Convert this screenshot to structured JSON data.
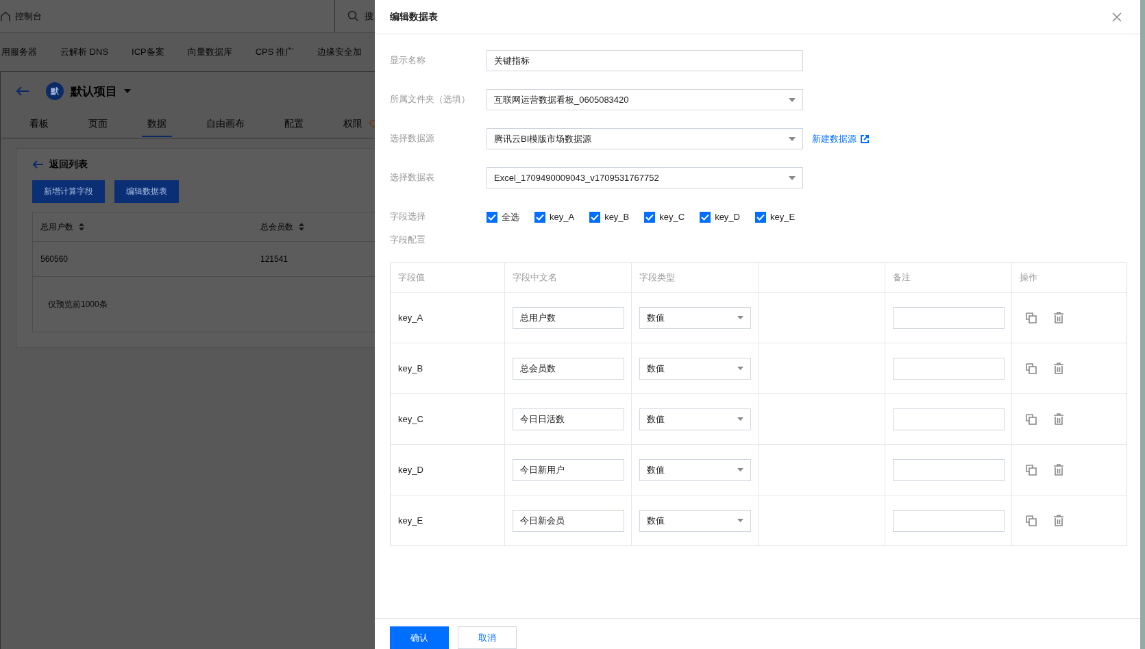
{
  "background": {
    "topbar": {
      "home_label": "控制台",
      "search_label": "搜"
    },
    "nav": [
      "用服务器",
      "云解析 DNS",
      "ICP备案",
      "向量数据库",
      "CPS 推广",
      "边缘安全加"
    ],
    "project": {
      "avatar": "默",
      "name": "默认项目"
    },
    "tabs": [
      {
        "label": "看板",
        "selected": false,
        "premium": false
      },
      {
        "label": "页面",
        "selected": false,
        "premium": false
      },
      {
        "label": "数据",
        "selected": true,
        "premium": false
      },
      {
        "label": "自由画布",
        "selected": false,
        "premium": false
      },
      {
        "label": "配置",
        "selected": false,
        "premium": false
      },
      {
        "label": "权限",
        "selected": false,
        "premium": true
      }
    ],
    "panel": {
      "back_label": "返回列表",
      "buttons": [
        "新增计算字段",
        "编辑数据表"
      ],
      "table": {
        "columns": [
          {
            "label": "总用户数",
            "sortable": true
          },
          {
            "label": "总会员数",
            "sortable": true
          }
        ],
        "rows": [
          [
            "560560",
            "121541"
          ]
        ],
        "footer": "仅预览前1000条"
      }
    }
  },
  "drawer": {
    "title": "编辑数据表",
    "form": [
      {
        "kind": "input",
        "label": "显示名称",
        "value": "关键指标"
      },
      {
        "kind": "select",
        "label": "所属文件夹（选填）",
        "value": "互联网运营数据看板_0605083420"
      },
      {
        "kind": "select",
        "label": "选择数据源",
        "value": "腾讯云BI模版市场数据源",
        "link": "新建数据源"
      },
      {
        "kind": "select",
        "label": "选择数据表",
        "value": "Excel_1709490009043_v1709531767752"
      }
    ],
    "fields": {
      "label": "字段选择",
      "options": [
        {
          "label": "全选",
          "checked": true
        },
        {
          "label": "key_A",
          "checked": true
        },
        {
          "label": "key_B",
          "checked": true
        },
        {
          "label": "key_C",
          "checked": true
        },
        {
          "label": "key_D",
          "checked": true
        },
        {
          "label": "key_E",
          "checked": true
        }
      ]
    },
    "config_label": "字段配置",
    "field_table": {
      "columns": [
        "字段值",
        "字段中文名",
        "字段类型",
        "",
        "备注",
        "操作"
      ],
      "rows": [
        {
          "key": "key_A",
          "name": "总用户数",
          "type": "数值"
        },
        {
          "key": "key_B",
          "name": "总会员数",
          "type": "数值"
        },
        {
          "key": "key_C",
          "name": "今日日活数",
          "type": "数值"
        },
        {
          "key": "key_D",
          "name": "今日新用户",
          "type": "数值"
        },
        {
          "key": "key_E",
          "name": "今日新会员",
          "type": "数值"
        }
      ]
    },
    "buttons": [
      {
        "label": "确认",
        "kind": "primary"
      },
      {
        "label": "取消",
        "kind": "secondary"
      }
    ]
  }
}
